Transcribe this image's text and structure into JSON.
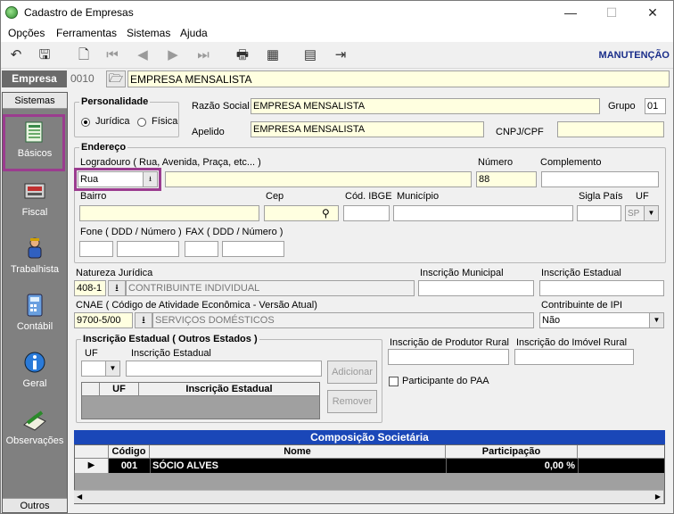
{
  "window": {
    "title": "Cadastro de Empresas",
    "minimize": "—",
    "maximize": "☐",
    "close": "✕"
  },
  "menu": [
    "Opções",
    "Ferramentas",
    "Sistemas",
    "Ajuda"
  ],
  "toolbar": {
    "mode": "MANUTENÇÃO"
  },
  "header": {
    "section": "Empresa",
    "code": "0010",
    "name": "EMPRESA MENSALISTA"
  },
  "sidebar": {
    "head": "Sistemas",
    "foot": "Outros",
    "items": [
      {
        "label": "Básicos",
        "icon": "book-icon"
      },
      {
        "label": "Fiscal",
        "icon": "calculator-tape-icon"
      },
      {
        "label": "Trabalhista",
        "icon": "worker-icon"
      },
      {
        "label": "Contábil",
        "icon": "calculator-icon"
      },
      {
        "label": "Geral",
        "icon": "info-icon"
      },
      {
        "label": "Observações",
        "icon": "notepad-pencil-icon"
      }
    ]
  },
  "personalidade": {
    "title": "Personalidade",
    "juridica": "Jurídica",
    "fisica": "Física"
  },
  "razao_social": {
    "label": "Razão Social",
    "value": "EMPRESA MENSALISTA"
  },
  "grupo": {
    "label": "Grupo",
    "value": "01"
  },
  "apelido": {
    "label": "Apelido",
    "value": "EMPRESA MENSALISTA"
  },
  "cnpj": {
    "label": "CNPJ/CPF",
    "value": ""
  },
  "endereco": {
    "title": "Endereço",
    "logradouro_label": "Logradouro ( Rua, Avenida, Praça, etc... )",
    "tipo": "Rua",
    "logradouro": "",
    "numero_label": "Número",
    "numero": "88",
    "complemento_label": "Complemento",
    "complemento": "",
    "bairro_label": "Bairro",
    "cep_label": "Cep",
    "ibge_label": "Cód. IBGE",
    "municipio_label": "Município",
    "sigla_label": "Sigla País",
    "uf_label": "UF",
    "uf": "SP",
    "fone_label": "Fone ( DDD / Número )",
    "fax_label": "FAX ( DDD / Número )"
  },
  "natureza": {
    "label": "Natureza Jurídica",
    "code": "408-1",
    "desc": "CONTRIBUINTE INDIVIDUAL"
  },
  "insc_municipal": {
    "label": "Inscrição Municipal"
  },
  "insc_estadual": {
    "label": "Inscrição Estadual"
  },
  "cnae": {
    "label": "CNAE ( Código de Atividade Econômica - Versão Atual)",
    "code": "9700-5/00",
    "desc": "SERVIÇOS DOMÉSTICOS"
  },
  "contrib_ipi": {
    "label": "Contribuinte de IPI",
    "value": "Não"
  },
  "ie_outros": {
    "title": "Inscrição Estadual ( Outros Estados )",
    "uf_label": "UF",
    "ie_label": "Inscrição Estadual",
    "col_uf": "UF",
    "col_ie": "Inscrição Estadual",
    "add": "Adicionar",
    "remove": "Remover"
  },
  "prod_rural": {
    "label": "Inscrição de Produtor Rural"
  },
  "imovel_rural": {
    "label": "Inscrição do Imóvel Rural"
  },
  "paa": {
    "label": "Participante do PAA"
  },
  "composicao": {
    "title": "Composição Societária",
    "cols": [
      "Código",
      "Nome",
      "Participação"
    ],
    "rows": [
      {
        "codigo": "001",
        "nome": "SÓCIO ALVES",
        "participacao": "0,00 %"
      }
    ]
  }
}
